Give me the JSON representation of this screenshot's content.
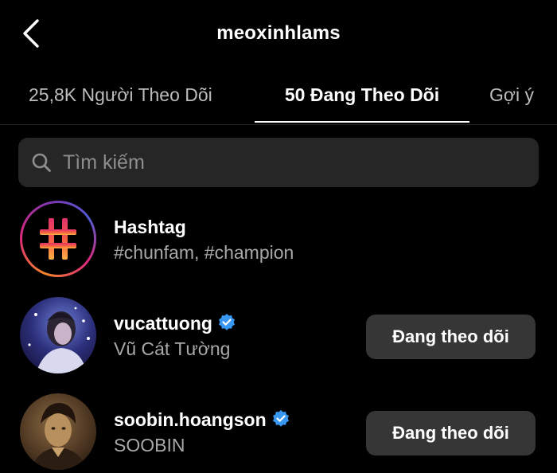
{
  "header": {
    "username": "meoxinhlams"
  },
  "tabs": [
    {
      "label": "25,8K Người Theo Dõi",
      "active": false
    },
    {
      "label": "50 Đang Theo Dõi",
      "active": true
    },
    {
      "label": "Gợi ý",
      "active": false
    }
  ],
  "search": {
    "placeholder": "Tìm kiếm",
    "value": ""
  },
  "list": [
    {
      "type": "hashtag",
      "name": "Hashtag",
      "subtitle": "#chunfam, #champion",
      "icon": "hashtag-icon"
    },
    {
      "type": "user",
      "name": "vucattuong",
      "subtitle": "Vũ Cát Tường",
      "verified": true,
      "button": "Đang theo dõi"
    },
    {
      "type": "user",
      "name": "soobin.hoangson",
      "subtitle": "SOOBIN",
      "verified": true,
      "button": "Đang theo dõi"
    }
  ],
  "colors": {
    "background": "#000000",
    "search_bg": "#262626",
    "button_bg": "#363636",
    "verified": "#3897f0",
    "secondary_text": "#a8a8a8"
  }
}
